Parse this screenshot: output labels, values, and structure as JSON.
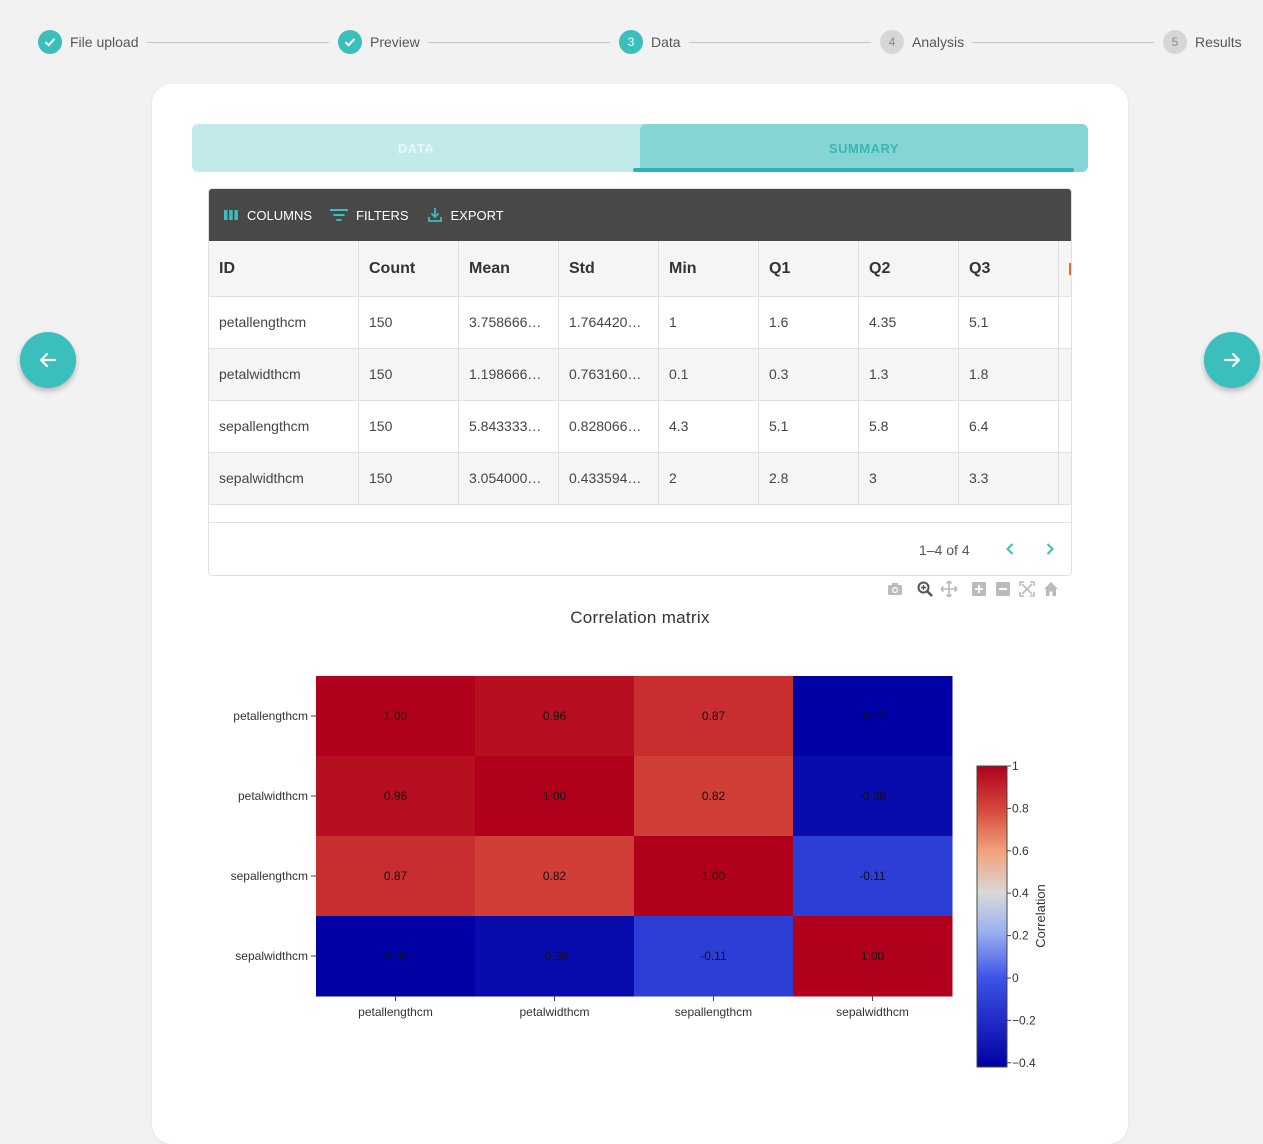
{
  "stepper": {
    "steps": [
      {
        "number": "1",
        "label": "File upload",
        "state": "done"
      },
      {
        "number": "2",
        "label": "Preview",
        "state": "done"
      },
      {
        "number": "3",
        "label": "Data",
        "state": "active"
      },
      {
        "number": "4",
        "label": "Analysis",
        "state": "pending"
      },
      {
        "number": "5",
        "label": "Results",
        "state": "pending"
      }
    ]
  },
  "tabs": {
    "data_label": "DATA",
    "summary_label": "SUMMARY",
    "selected": "SUMMARY"
  },
  "toolbar": {
    "columns_label": "COLUMNS",
    "filters_label": "FILTERS",
    "export_label": "EXPORT"
  },
  "table": {
    "headers": [
      "ID",
      "Count",
      "Mean",
      "Std",
      "Min",
      "Q1",
      "Q2",
      "Q3"
    ],
    "rows": [
      [
        "petallengthcm",
        "150",
        "3.758666…",
        "1.764420…",
        "1",
        "1.6",
        "4.35",
        "5.1"
      ],
      [
        "petalwidthcm",
        "150",
        "1.198666…",
        "0.763160…",
        "0.1",
        "0.3",
        "1.3",
        "1.8"
      ],
      [
        "sepallengthcm",
        "150",
        "5.843333…",
        "0.828066…",
        "4.3",
        "5.1",
        "5.8",
        "6.4"
      ],
      [
        "sepalwidthcm",
        "150",
        "3.054000…",
        "0.433594…",
        "2",
        "2.8",
        "3",
        "3.3"
      ]
    ]
  },
  "pagination": {
    "text": "1–4 of 4"
  },
  "colors": {
    "accent": "#3bbfbd",
    "toolbar_bg": "#484848"
  },
  "chart_data": {
    "type": "heatmap",
    "title": "Correlation matrix",
    "x": [
      "petallengthcm",
      "petalwidthcm",
      "sepallengthcm",
      "sepalwidthcm"
    ],
    "y": [
      "petallengthcm",
      "petalwidthcm",
      "sepallengthcm",
      "sepalwidthcm"
    ],
    "z": [
      [
        1.0,
        0.96,
        0.87,
        -0.42
      ],
      [
        0.96,
        1.0,
        0.82,
        -0.36
      ],
      [
        0.87,
        0.82,
        1.0,
        -0.11
      ],
      [
        -0.42,
        -0.36,
        -0.11,
        1.0
      ]
    ],
    "z_labels": [
      [
        "1.00",
        "0.96",
        "0.87",
        "-0.42"
      ],
      [
        "0.96",
        "1.00",
        "0.82",
        "-0.36"
      ],
      [
        "0.87",
        "0.82",
        "1.00",
        "-0.11"
      ],
      [
        "-0.42",
        "-0.36",
        "-0.11",
        "1.00"
      ]
    ],
    "zmin": -0.42,
    "zmax": 1.0,
    "colorscale": "coolwarm",
    "colorbar_title": "Correlation",
    "colorbar_ticks": [
      "1",
      "0.8",
      "0.6",
      "0.4",
      "0.2",
      "0",
      "−0.2",
      "−0.4"
    ],
    "colorbar_tick_values": [
      1,
      0.8,
      0.6,
      0.4,
      0.2,
      0,
      -0.2,
      -0.4
    ]
  }
}
